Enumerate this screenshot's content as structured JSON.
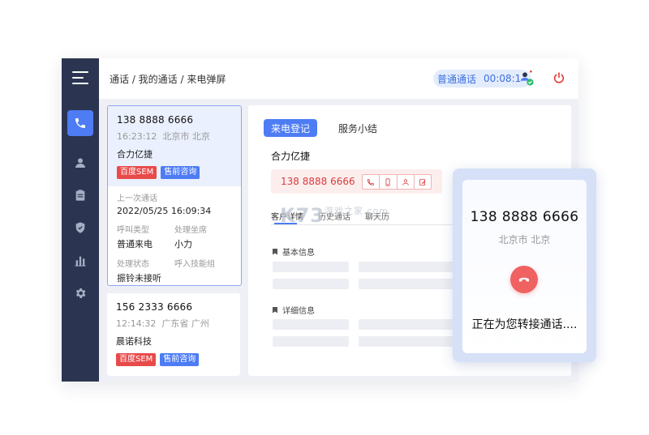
{
  "header": {
    "breadcrumb": "通话 / 我的通话 / 来电弹屏",
    "call_type": "普通通话",
    "call_timer": "00:08:12"
  },
  "sidebar": {
    "items": [
      {
        "icon": "phone-icon",
        "active": true
      },
      {
        "icon": "user-icon",
        "active": false
      },
      {
        "icon": "clipboard-icon",
        "active": false
      },
      {
        "icon": "shield-icon",
        "active": false
      },
      {
        "icon": "bar-chart-icon",
        "active": false
      },
      {
        "icon": "gear-icon",
        "active": false
      }
    ]
  },
  "calls": [
    {
      "phone": "138 8888 6666",
      "time": "16:23:12",
      "location": "北京市 北京",
      "company": "合力亿捷",
      "tags": [
        "百度SEM",
        "售前咨询"
      ],
      "last_call_label": "上一次通话",
      "last_call_value": "2022/05/25  16:09:34",
      "call_type_label": "呼叫类型",
      "call_type_value": "普通来电",
      "handler_label": "处理坐席",
      "handler_value": "小力",
      "status_label": "处理状态",
      "status_value": "振铃未接听",
      "skill_group_label": "呼入技能组"
    },
    {
      "phone": "156 2333 6666",
      "time": "12:14:32",
      "location": "广东省 广州",
      "company": "晨诺科技",
      "tags": [
        "百度SEM",
        "售前咨询"
      ]
    }
  ],
  "main": {
    "tabs": [
      "来电登记",
      "服务小结"
    ],
    "company": "合力亿捷",
    "phone": "138 8888 6666",
    "subtabs": [
      "客户详情",
      "历史通话",
      "聊天历"
    ],
    "section_basic": "基本信息",
    "section_detail": "详细信息"
  },
  "watermark": {
    "main": "K73",
    "sub": "游戏之家",
    "domain": ".com"
  },
  "popup": {
    "phone": "138 8888 6666",
    "location": "北京市 北京",
    "status": "正在为您转接通话...."
  },
  "colors": {
    "accent": "#4d7cf4",
    "sidebar": "#2b3551",
    "danger": "#f06161",
    "tag_red": "#e84a4a"
  }
}
